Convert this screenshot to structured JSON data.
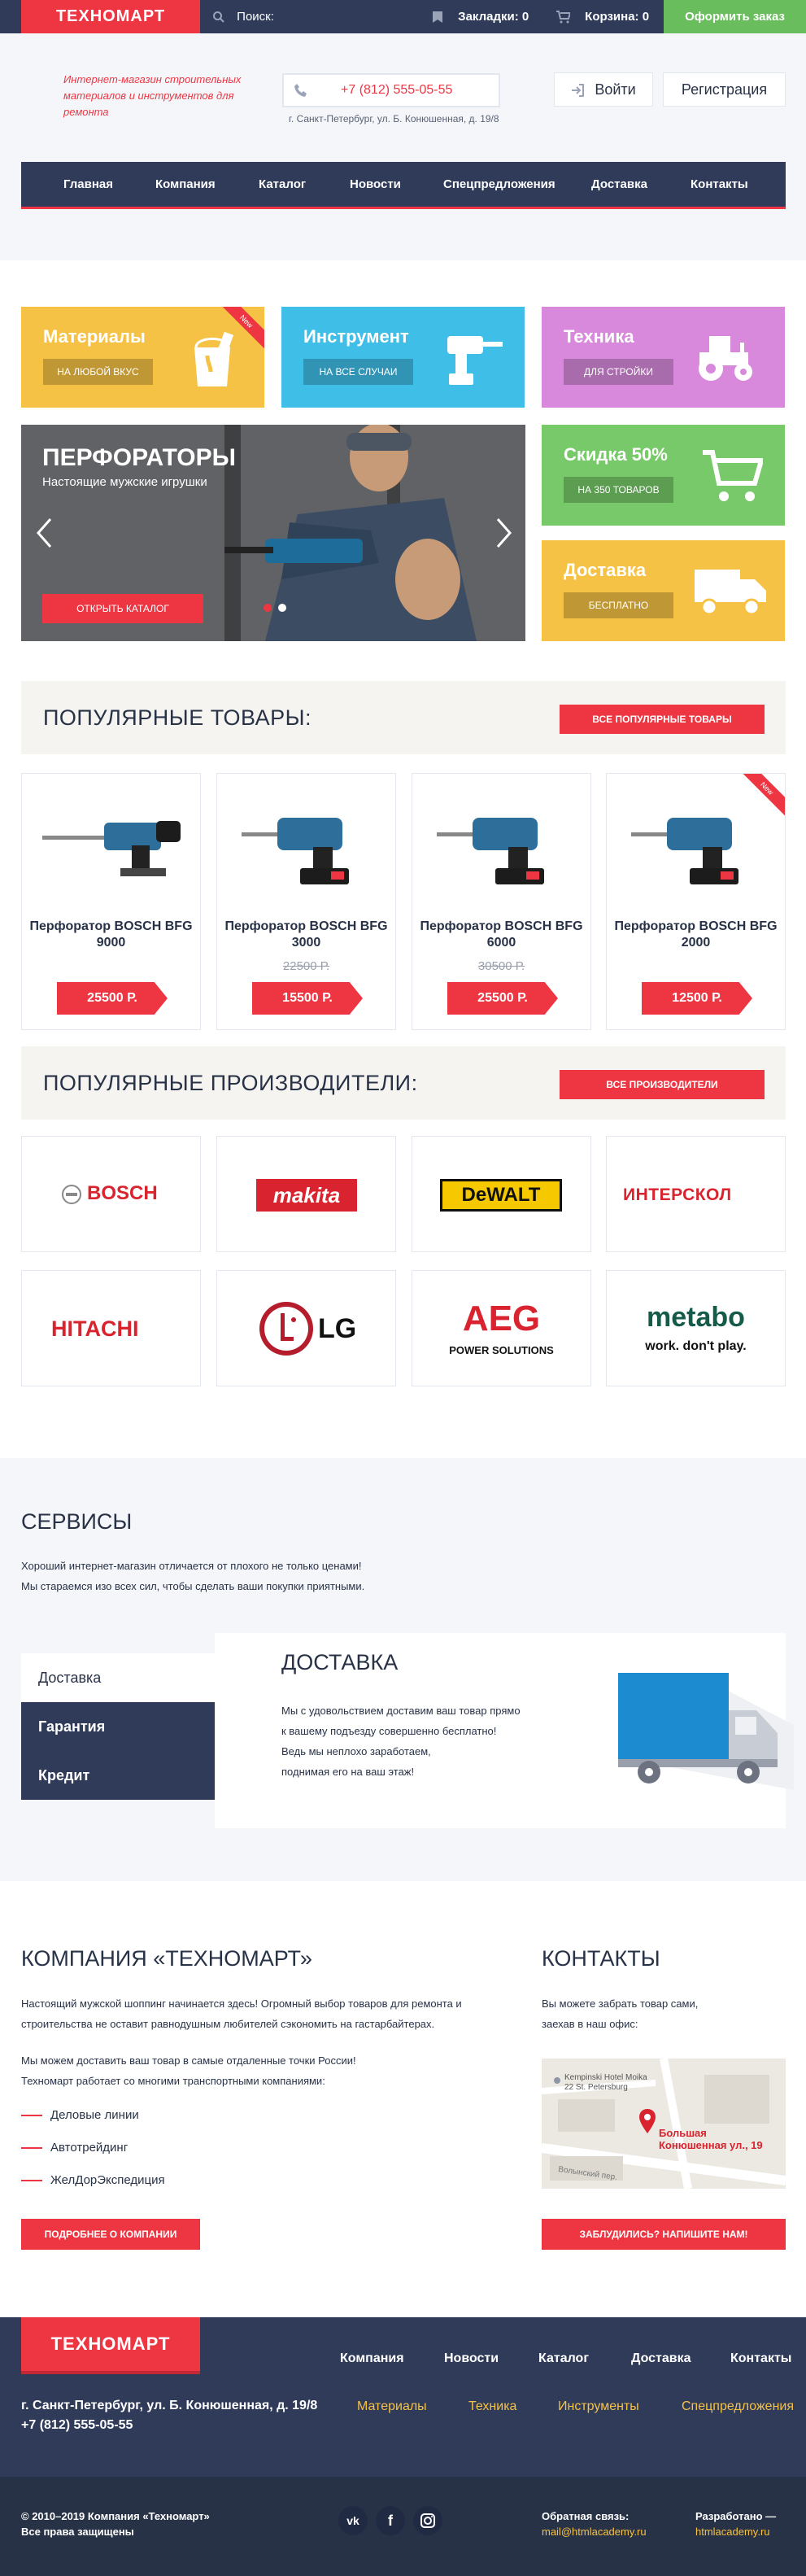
{
  "topbar": {
    "logo": "ТЕХНОМАРТ",
    "search_placeholder": "Поиск:",
    "bookmarks": "Закладки: 0",
    "cart": "Корзина: 0",
    "order": "Оформить заказ"
  },
  "header": {
    "slogan": "Интернет-магазин строительных материалов и инструментов для ремонта",
    "phone": "+7 (812) 555-05-55",
    "address": "г. Санкт-Петербург, ул. Б. Конюшенная, д. 19/8",
    "login": "Войти",
    "register": "Регистрация"
  },
  "nav": [
    "Главная",
    "Компания",
    "Каталог",
    "Новости",
    "Спецпредложения",
    "Доставка",
    "Контакты"
  ],
  "tiles": [
    {
      "title": "Материалы",
      "button": "На любой вкус",
      "color": "#f6c245",
      "ribbon": "New"
    },
    {
      "title": "Инструмент",
      "button": "На все случаи",
      "color": "#3fbee8"
    },
    {
      "title": "Техника",
      "button": "Для стройки",
      "color": "#d889dc"
    },
    {
      "title": "Скидка 50%",
      "button": "На 350 товаров",
      "color": "#77c969"
    },
    {
      "title": "Доставка",
      "button": "Бесплатно",
      "color": "#f6c245"
    }
  ],
  "slider": {
    "title": "ПЕРФОРАТОРЫ",
    "subtitle": "Настоящие мужские игрушки",
    "button": "Открыть каталог"
  },
  "popular": {
    "title": "ПОПУЛЯРНЫЕ ТОВАРЫ:",
    "button": "Все популярные товары",
    "items": [
      {
        "name": "Перфоратор BOSCH BFG 9000",
        "old": "",
        "price": "25500 Р."
      },
      {
        "name": "Перфоратор BOSCH BFG 3000",
        "old": "22500 Р.",
        "price": "15500 Р."
      },
      {
        "name": "Перфоратор BOSCH BFG 6000",
        "old": "30500 Р.",
        "price": "25500 Р."
      },
      {
        "name": "Перфоратор BOSCH BFG 2000",
        "old": "",
        "price": "12500 Р.",
        "ribbon": "New"
      }
    ]
  },
  "brands": {
    "title": "ПОПУЛЯРНЫЕ ПРОИЗВОДИТЕЛИ:",
    "button": "Все производители",
    "names": [
      "BOSCH",
      "makita",
      "DeWALT",
      "ИНТЕРСКОЛ",
      "HITACHI",
      "LG",
      "AEG",
      "metabo"
    ],
    "sub": {
      "aeg": "POWER SOLUTIONS",
      "metabo": "work. don't play."
    }
  },
  "services": {
    "title": "СЕРВИСЫ",
    "text1": "Хороший интернет-магазин отличается от плохого не только ценами!",
    "text2": "Мы стараемся изо всех сил, чтобы сделать ваши покупки приятными.",
    "tabs": [
      "Доставка",
      "Гарантия",
      "Кредит"
    ],
    "delivery_title": "ДОСТАВКА",
    "delivery_lines": [
      "Мы с удовольствием доставим ваш товар прямо",
      "к вашему подъезду совершенно бесплатно!",
      "Ведь мы неплохо заработаем,",
      "поднимая его на ваш этаж!"
    ]
  },
  "company": {
    "title": "КОМПАНИЯ «ТЕХНОМАРТ»",
    "p1a": "Настоящий мужской шоппинг начинается здесь! Огромный выбор товаров для ремонта и",
    "p1b": "строительства не оставит равнодушным любителей сэкономить на гастарбайтерах.",
    "p2a": "Мы можем доставить ваш товар в самые отдаленные точки России!",
    "p2b": "Техномарт работает со многими транспортными компаниями:",
    "partners": [
      "Деловые линии",
      "Автотрейдинг",
      "ЖелДорЭкспедиция"
    ],
    "button": "Подробнее о компании"
  },
  "contacts": {
    "title": "КОНТАКТЫ",
    "l1": "Вы можете забрать товар сами,",
    "l2": "заехав в наш офис:",
    "map_hotel": "Kempinski Hotel Moika",
    "map_hotel2": "22 St. Petersburg",
    "map_label1": "Большая",
    "map_label2": "Конюшенная ул., 19",
    "map_street": "Волынский пер.",
    "button": "Заблудились? Напишите нам!"
  },
  "footer": {
    "logo": "ТЕХНОМАРТ",
    "nav1": [
      "Компания",
      "Новости",
      "Каталог",
      "Доставка",
      "Контакты"
    ],
    "nav2": [
      "Материалы",
      "Техника",
      "Инструменты",
      "Спецпредложения"
    ],
    "address": "г. Санкт-Петербург, ул. Б. Конюшенная, д. 19/8",
    "phone": "+7 (812) 555-05-55",
    "copy1": "© 2010–2019 Компания «Техномарт»",
    "copy2": "Все права защищены",
    "feedback_label": "Обратная связь:",
    "feedback_email": "mail@htmlacademy.ru",
    "dev_label": "Разработано —",
    "dev_site": "htmlacademy.ru",
    "social": [
      "vk",
      "facebook",
      "instagram"
    ]
  }
}
